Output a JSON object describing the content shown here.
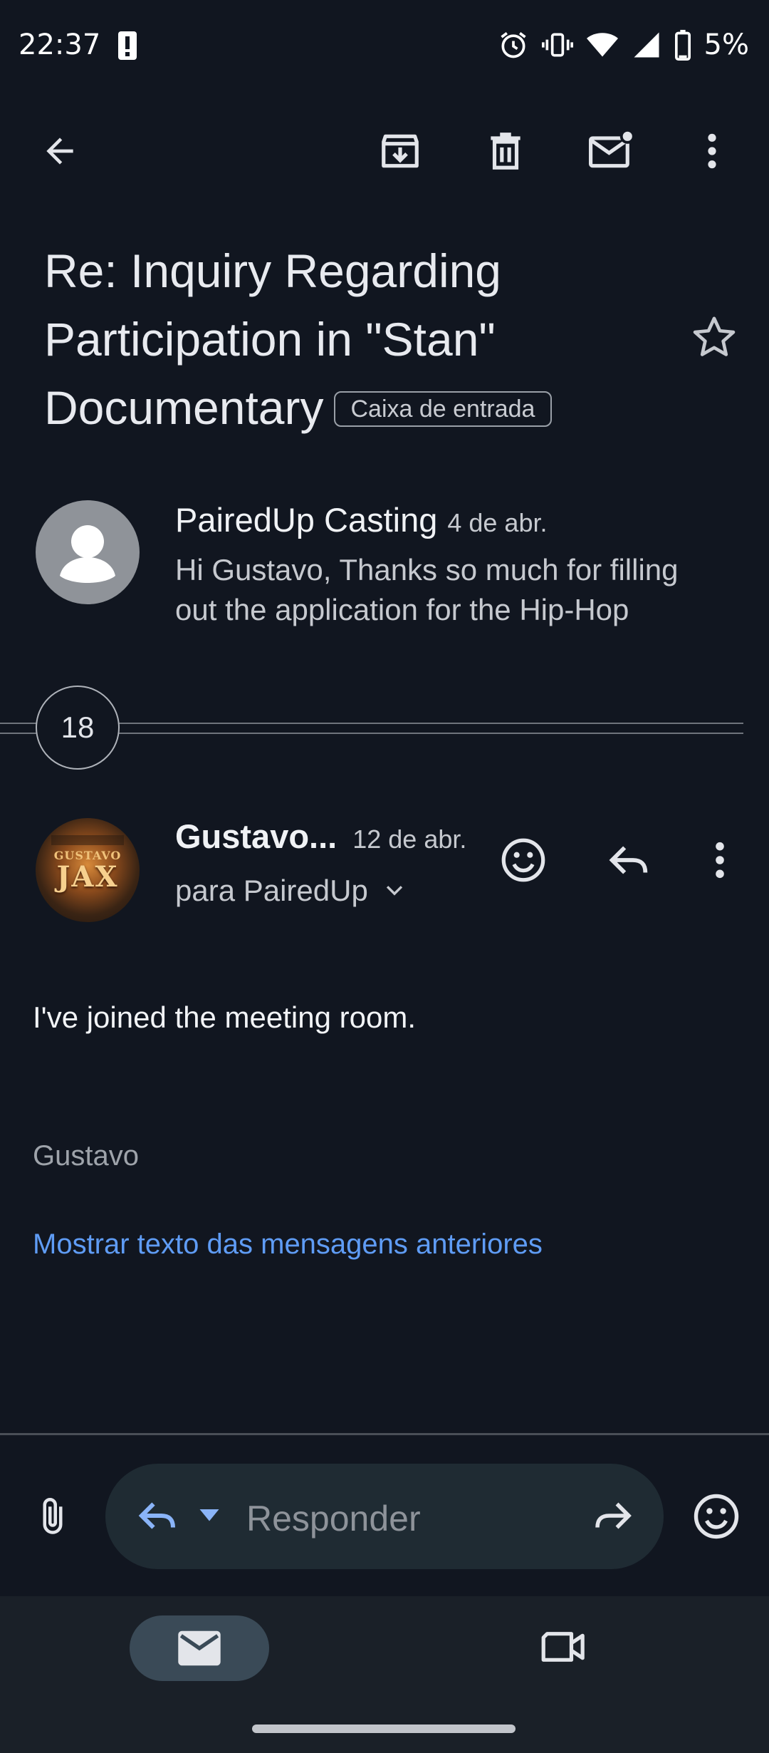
{
  "status_bar": {
    "time": "22:37",
    "battery": "5%",
    "icons": [
      "alert-icon",
      "alarm-icon",
      "vibrate-icon",
      "wifi-icon",
      "signal-icon",
      "battery-icon"
    ]
  },
  "toolbar": {
    "icons": [
      "back-arrow-icon",
      "archive-icon",
      "delete-icon",
      "mark-unread-icon",
      "more-vert-icon"
    ]
  },
  "email": {
    "subject": "Re: Inquiry Regarding Participation in \"Stan\" Documentary",
    "label": "Caixa de entrada"
  },
  "message1": {
    "sender": "PairedUp Casting",
    "date": "4 de abr.",
    "snippet": "Hi Gustavo, Thanks so much for filling out the application for the Hip-Hop"
  },
  "collapsed": {
    "count": "18"
  },
  "message2": {
    "sender": "Gustavo...",
    "date": "12 de abr.",
    "to": "para PairedUp",
    "avatar_text": "GUSTAVO JAX",
    "body": "I've joined the meeting room.",
    "signature": "Gustavo",
    "show_quoted": "Mostrar texto das mensagens anteriores"
  },
  "reply_bar": {
    "placeholder": "Responder"
  },
  "bottom_nav": {
    "items": [
      "mail-icon",
      "video-icon"
    ]
  },
  "colors": {
    "background": "#111620",
    "link": "#5f9cf5",
    "reply_accent": "#8ab4f8"
  }
}
